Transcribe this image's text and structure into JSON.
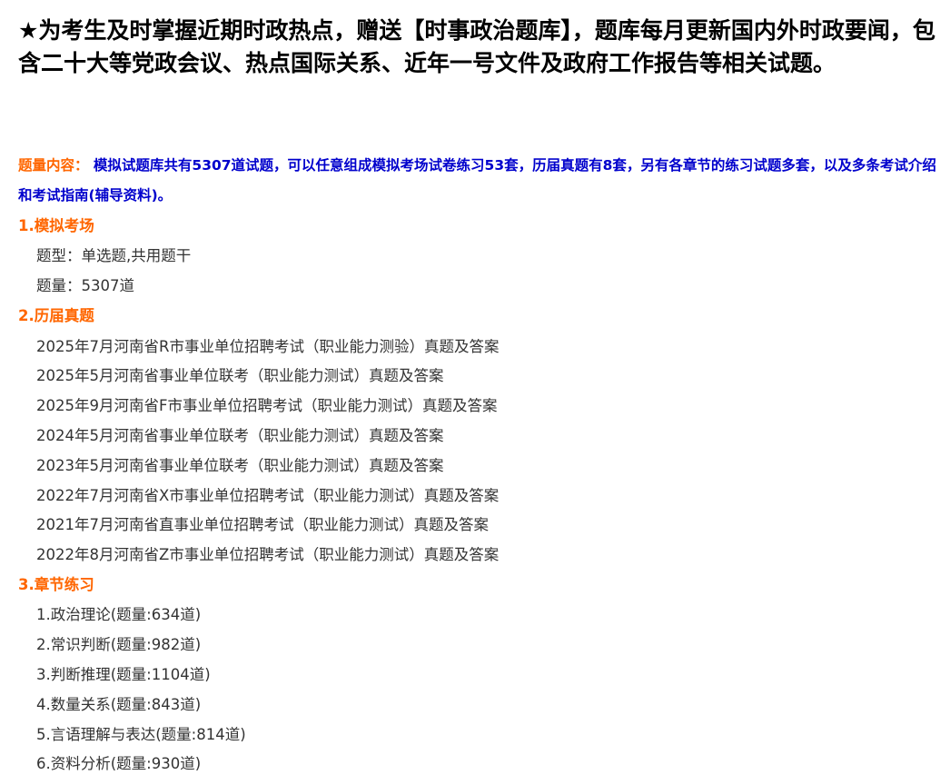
{
  "banner": {
    "text": "★为考生及时掌握近期时政热点，赠送【时事政治题库】，题库每月更新国内外时政要闻，包含二十大等党政会议、热点国际关系、近年一号文件及政府工作报告等相关试题。"
  },
  "intro": {
    "label": "题量内容：",
    "text": " 模拟试题库共有5307道试题，可以任意组成模拟考场试卷练习53套，历届真题有8套，另有各章节的练习试题多套，以及多条考试介绍和考试指南(辅导资料)。"
  },
  "sections": {
    "mock": {
      "title": "1.模拟考场",
      "type_label": "题型：",
      "type_value": "单选题,共用题干",
      "count_label": "题量：",
      "count_value": "5307道"
    },
    "past": {
      "title": "2.历届真题",
      "items": [
        "2025年7月河南省R市事业单位招聘考试（职业能力测验）真题及答案",
        "2025年5月河南省事业单位联考（职业能力测试）真题及答案",
        "2025年9月河南省F市事业单位招聘考试（职业能力测试）真题及答案",
        "2024年5月河南省事业单位联考（职业能力测试）真题及答案",
        "2023年5月河南省事业单位联考（职业能力测试）真题及答案",
        "2022年7月河南省X市事业单位招聘考试（职业能力测试）真题及答案",
        "2021年7月河南省直事业单位招聘考试（职业能力测试）真题及答案",
        "2022年8月河南省Z市事业单位招聘考试（职业能力测试）真题及答案"
      ]
    },
    "chapters": {
      "title": "3.章节练习",
      "items": [
        "1.政治理论(题量:634道)",
        "2.常识判断(题量:982道)",
        "3.判断推理(题量:1104道)",
        "4.数量关系(题量:843道)",
        "5.言语理解与表达(题量:814道)",
        "6.资料分析(题量:930道)"
      ]
    }
  }
}
